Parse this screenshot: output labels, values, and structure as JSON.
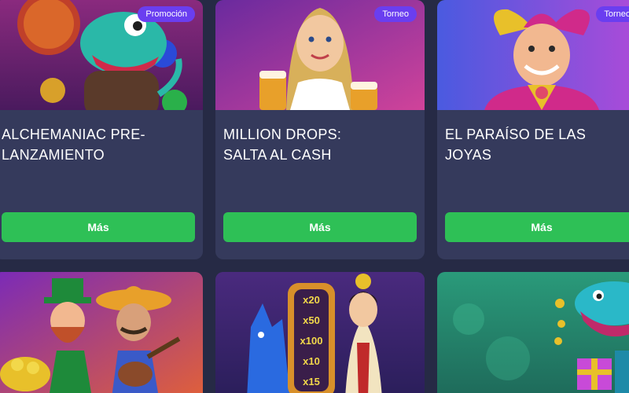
{
  "cards": [
    {
      "badge": "Promoción",
      "title": "ALCHEMANIAC PRE-\nLANZAMIENTO",
      "button_label": "Más",
      "art_icon": "dragon-alchemist-icon",
      "colors": {
        "bg_top": "#d04a2a",
        "bg_bottom": "#7a1e6e"
      }
    },
    {
      "badge": "Torneo",
      "title": "MILLION DROPS:\nSALTA AL CASH",
      "button_label": "Más",
      "art_icon": "beer-maiden-icon",
      "colors": {
        "bg_top": "#8a2a9e",
        "bg_bottom": "#d0439a"
      }
    },
    {
      "badge": "Torneo",
      "title": "EL PARAÍSO DE LAS\nJOYAS",
      "button_label": "Más",
      "art_icon": "jester-icon",
      "colors": {
        "bg_top": "#5a6ae0",
        "bg_bottom": "#a34ad8"
      }
    },
    {
      "badge": "",
      "title": "",
      "button_label": "",
      "art_icon": "leprechaun-mariachi-icon",
      "colors": {
        "bg_top": "#8a2abe",
        "bg_bottom": "#e05a3a"
      }
    },
    {
      "badge": "",
      "title": "",
      "button_label": "",
      "art_icon": "wolf-geisha-multiplier-icon",
      "colors": {
        "bg_top": "#4a2a7e",
        "bg_bottom": "#2a1e5a"
      },
      "multipliers": [
        "x20",
        "x50",
        "x100",
        "x10",
        "x15"
      ]
    },
    {
      "badge": "",
      "title": "",
      "button_label": "",
      "art_icon": "dinosaur-gift-icon",
      "colors": {
        "bg_top": "#2a9a7a",
        "bg_bottom": "#1e6a5a"
      }
    }
  ],
  "accent": {
    "button": "#2ec056",
    "badge": "#6a3ef0",
    "card": "#353a5c",
    "page": "#262a45"
  }
}
